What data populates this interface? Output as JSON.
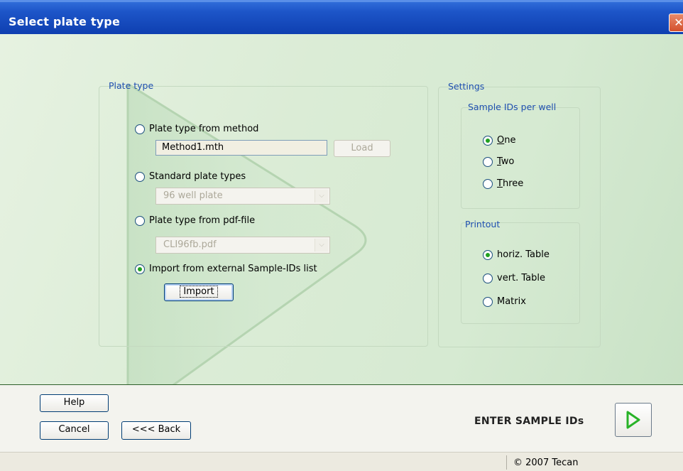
{
  "window": {
    "title": "Select plate type",
    "close_symbol": "✕"
  },
  "plate_type": {
    "legend": "Plate type",
    "options": [
      {
        "label": "Plate type from method",
        "checked": false
      },
      {
        "label": "Standard plate types",
        "checked": false
      },
      {
        "label": "Plate type from pdf-file",
        "checked": false
      },
      {
        "label": "Import from external Sample-IDs list",
        "checked": true
      }
    ],
    "method_file": "Method1.mth",
    "load_label": "Load",
    "standard_select": "96 well plate",
    "pdf_select": "CLI96fb.pdf",
    "import_label": "Import"
  },
  "settings": {
    "legend": "Settings",
    "sample_ids": {
      "legend": "Sample IDs per well",
      "options": [
        {
          "access": "O",
          "rest": "ne",
          "checked": true
        },
        {
          "access": "T",
          "rest": "wo",
          "checked": false
        },
        {
          "access": "T",
          "rest": "hree",
          "checked": false
        }
      ]
    },
    "printout": {
      "legend": "Printout",
      "options": [
        {
          "label": "horiz. Table",
          "checked": true
        },
        {
          "label": "vert. Table",
          "checked": false
        },
        {
          "label": "Matrix",
          "checked": false
        }
      ]
    }
  },
  "footer": {
    "help_label": "Help",
    "cancel_label": "Cancel",
    "back_label": "<<< Back",
    "next_step_label": "ENTER SAMPLE IDs"
  },
  "status": {
    "copyright": "© 2007 Tecan"
  },
  "colors": {
    "title_bar": "#0e3fb0",
    "legend_text": "#1f4fb0",
    "next_arrow": "#28b328"
  }
}
